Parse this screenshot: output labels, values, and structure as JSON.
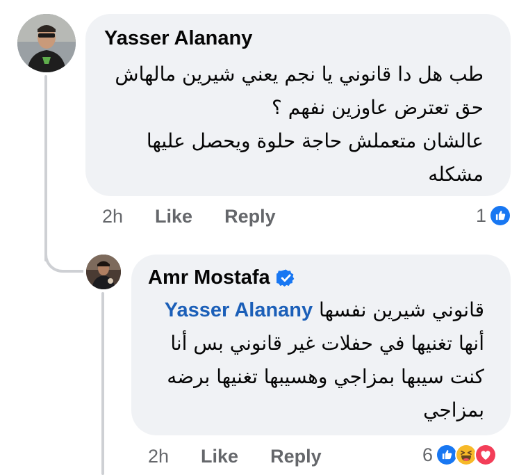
{
  "comments": [
    {
      "author": "Yasser Alanany",
      "lines": [
        "طب هل دا قانوني يا نجم يعني شيرين مالهاش",
        "حق تعترض عاوزين نفهم ؟",
        "عالشان متعملش حاجة حلوة ويحصل عليها",
        "مشكله"
      ],
      "time": "2h",
      "like_label": "Like",
      "reply_label": "Reply",
      "reaction_count": "1",
      "reactions": [
        "like-icon"
      ]
    },
    {
      "author": "Amr Mostafa",
      "verified": true,
      "mention": "Yasser Alanany",
      "first_line_text": "قانوني شيرين نفسها",
      "lines": [
        "أنها تغنيها في حفلات غير قانوني بس أنا",
        "كنت سيبها بمزاجي وهسيبها تغنيها برضه",
        "بمزاجي"
      ],
      "time": "2h",
      "like_label": "Like",
      "reply_label": "Reply",
      "reaction_count": "6",
      "reactions": [
        "like-icon",
        "haha-icon",
        "love-icon"
      ]
    }
  ],
  "colors": {
    "bubble": "#f0f2f5",
    "meta_text": "#65676b",
    "mention": "#1b5fb8",
    "like_blue": "#1877f2",
    "love_red": "#f33e58",
    "haha_yellow": "#f7b928"
  }
}
